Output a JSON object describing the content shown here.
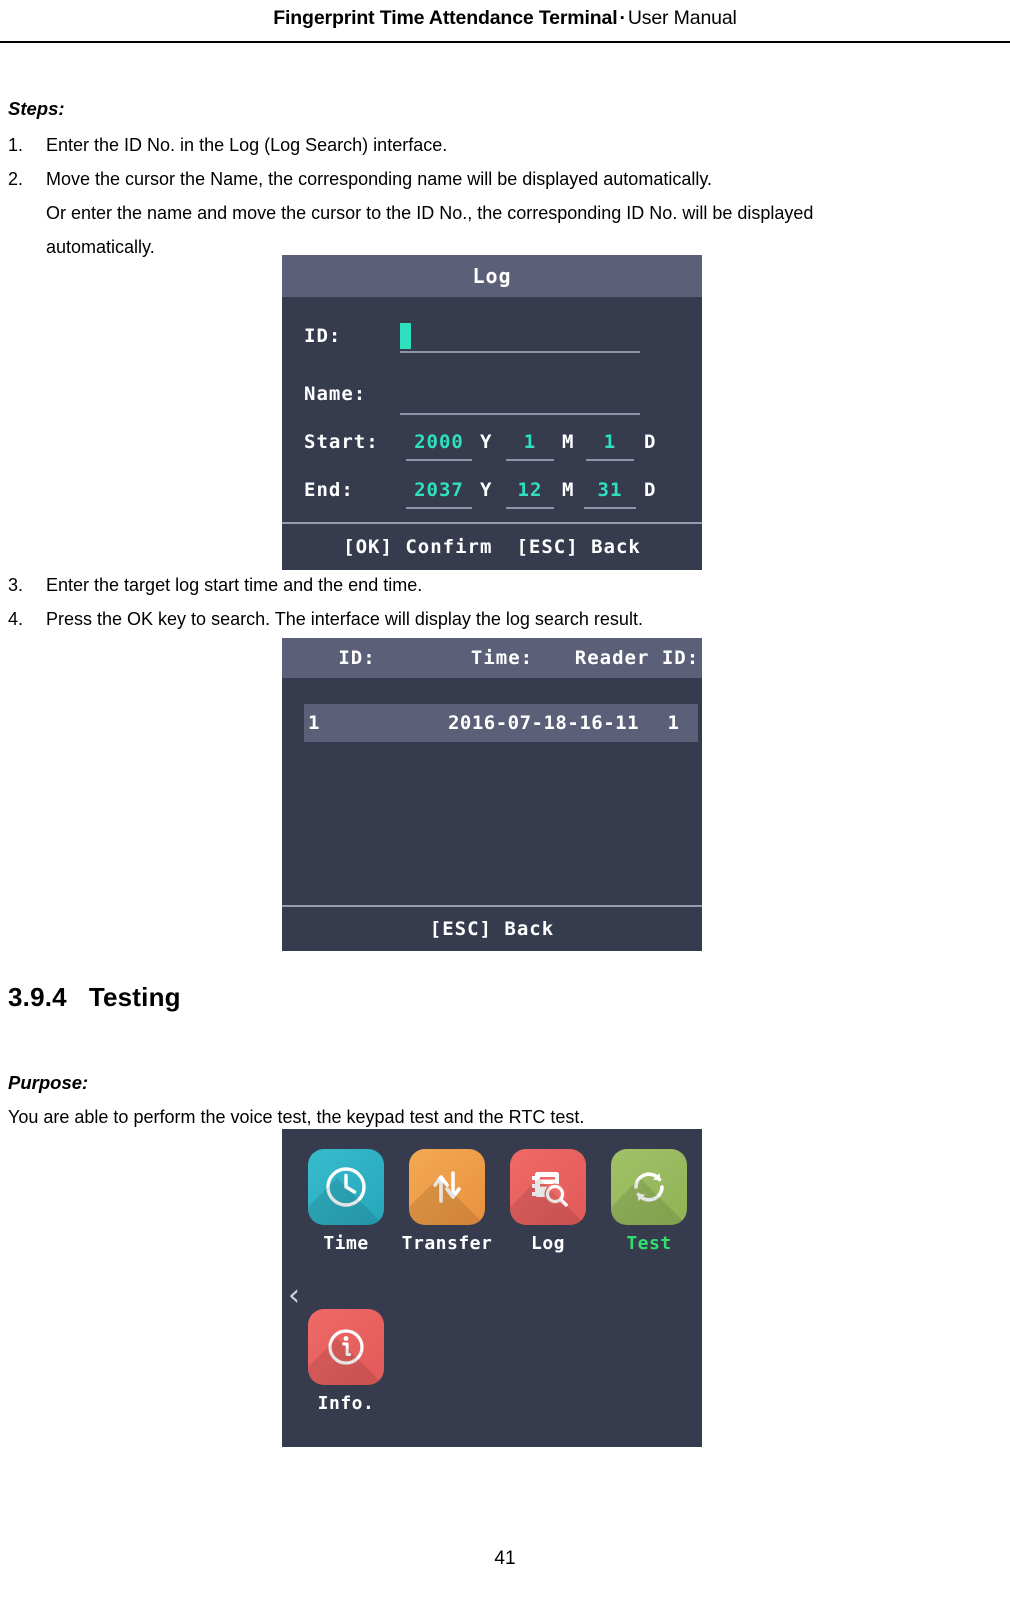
{
  "header": {
    "title_bold": "Fingerprint Time Attendance Terminal",
    "separator": "·",
    "title_normal": "User Manual"
  },
  "page_number": "41",
  "body": {
    "steps_label": "Steps:",
    "steps": [
      {
        "num": "1.",
        "text": "Enter the ID No. in the Log (Log Search) interface."
      },
      {
        "num": "2.",
        "text": "Move the cursor the Name, the corresponding name will be displayed automatically."
      },
      {
        "num": "3.",
        "text": "Enter the target log start time and the end time."
      },
      {
        "num": "4.",
        "text": "Press the OK key to search. The interface will display the log search result."
      }
    ],
    "step2_cont_line1": "Or enter the name and move the cursor to the ID No., the corresponding ID No. will be displayed",
    "step2_cont_line2": "automatically.",
    "section": {
      "number": "3.9.4",
      "title": "Testing"
    },
    "purpose_label": "Purpose:",
    "purpose_text": "You are able to perform the voice test, the keypad test and the RTC test."
  },
  "screen_log": {
    "title": "Log",
    "fields": {
      "id_label": "ID:",
      "id_value": "",
      "name_label": "Name:",
      "name_value": "",
      "start_label": "Start:",
      "start_year": "2000",
      "start_year_unit": "Y",
      "start_month": "1",
      "start_month_unit": "M",
      "start_day": "1",
      "start_day_unit": "D",
      "end_label": "End:",
      "end_year": "2037",
      "end_year_unit": "Y",
      "end_month": "12",
      "end_month_unit": "M",
      "end_day": "31",
      "end_day_unit": "D"
    },
    "footer_confirm": "[OK] Confirm",
    "footer_back": "[ESC] Back"
  },
  "screen_result": {
    "columns": {
      "id": "ID:",
      "time": "Time:",
      "reader_id": "Reader ID:"
    },
    "rows": [
      {
        "id": "1",
        "time": "2016-07-18-16-11",
        "reader_id": "1"
      }
    ],
    "footer_back": "[ESC] Back"
  },
  "screen_menu": {
    "items": [
      {
        "label": "Time",
        "icon": "clock-icon",
        "selected": false
      },
      {
        "label": "Transfer",
        "icon": "transfer-arrows-icon",
        "selected": false
      },
      {
        "label": "Log",
        "icon": "log-search-icon",
        "selected": false
      },
      {
        "label": "Test",
        "icon": "refresh-icon",
        "selected": true
      },
      {
        "label": "Info.",
        "icon": "info-icon",
        "selected": false
      }
    ],
    "prev_arrow": "‹"
  },
  "colors": {
    "screen_bg": "#363b4e",
    "titlebar": "#5c5f78",
    "accent_green": "#2fe0c0",
    "selected_green": "#2fe06e",
    "tile_time": "#36bccd",
    "tile_transfer": "#f4a951",
    "tile_log": "#ef6a66",
    "tile_test": "#a2c166",
    "tile_info": "#ef6a66"
  }
}
